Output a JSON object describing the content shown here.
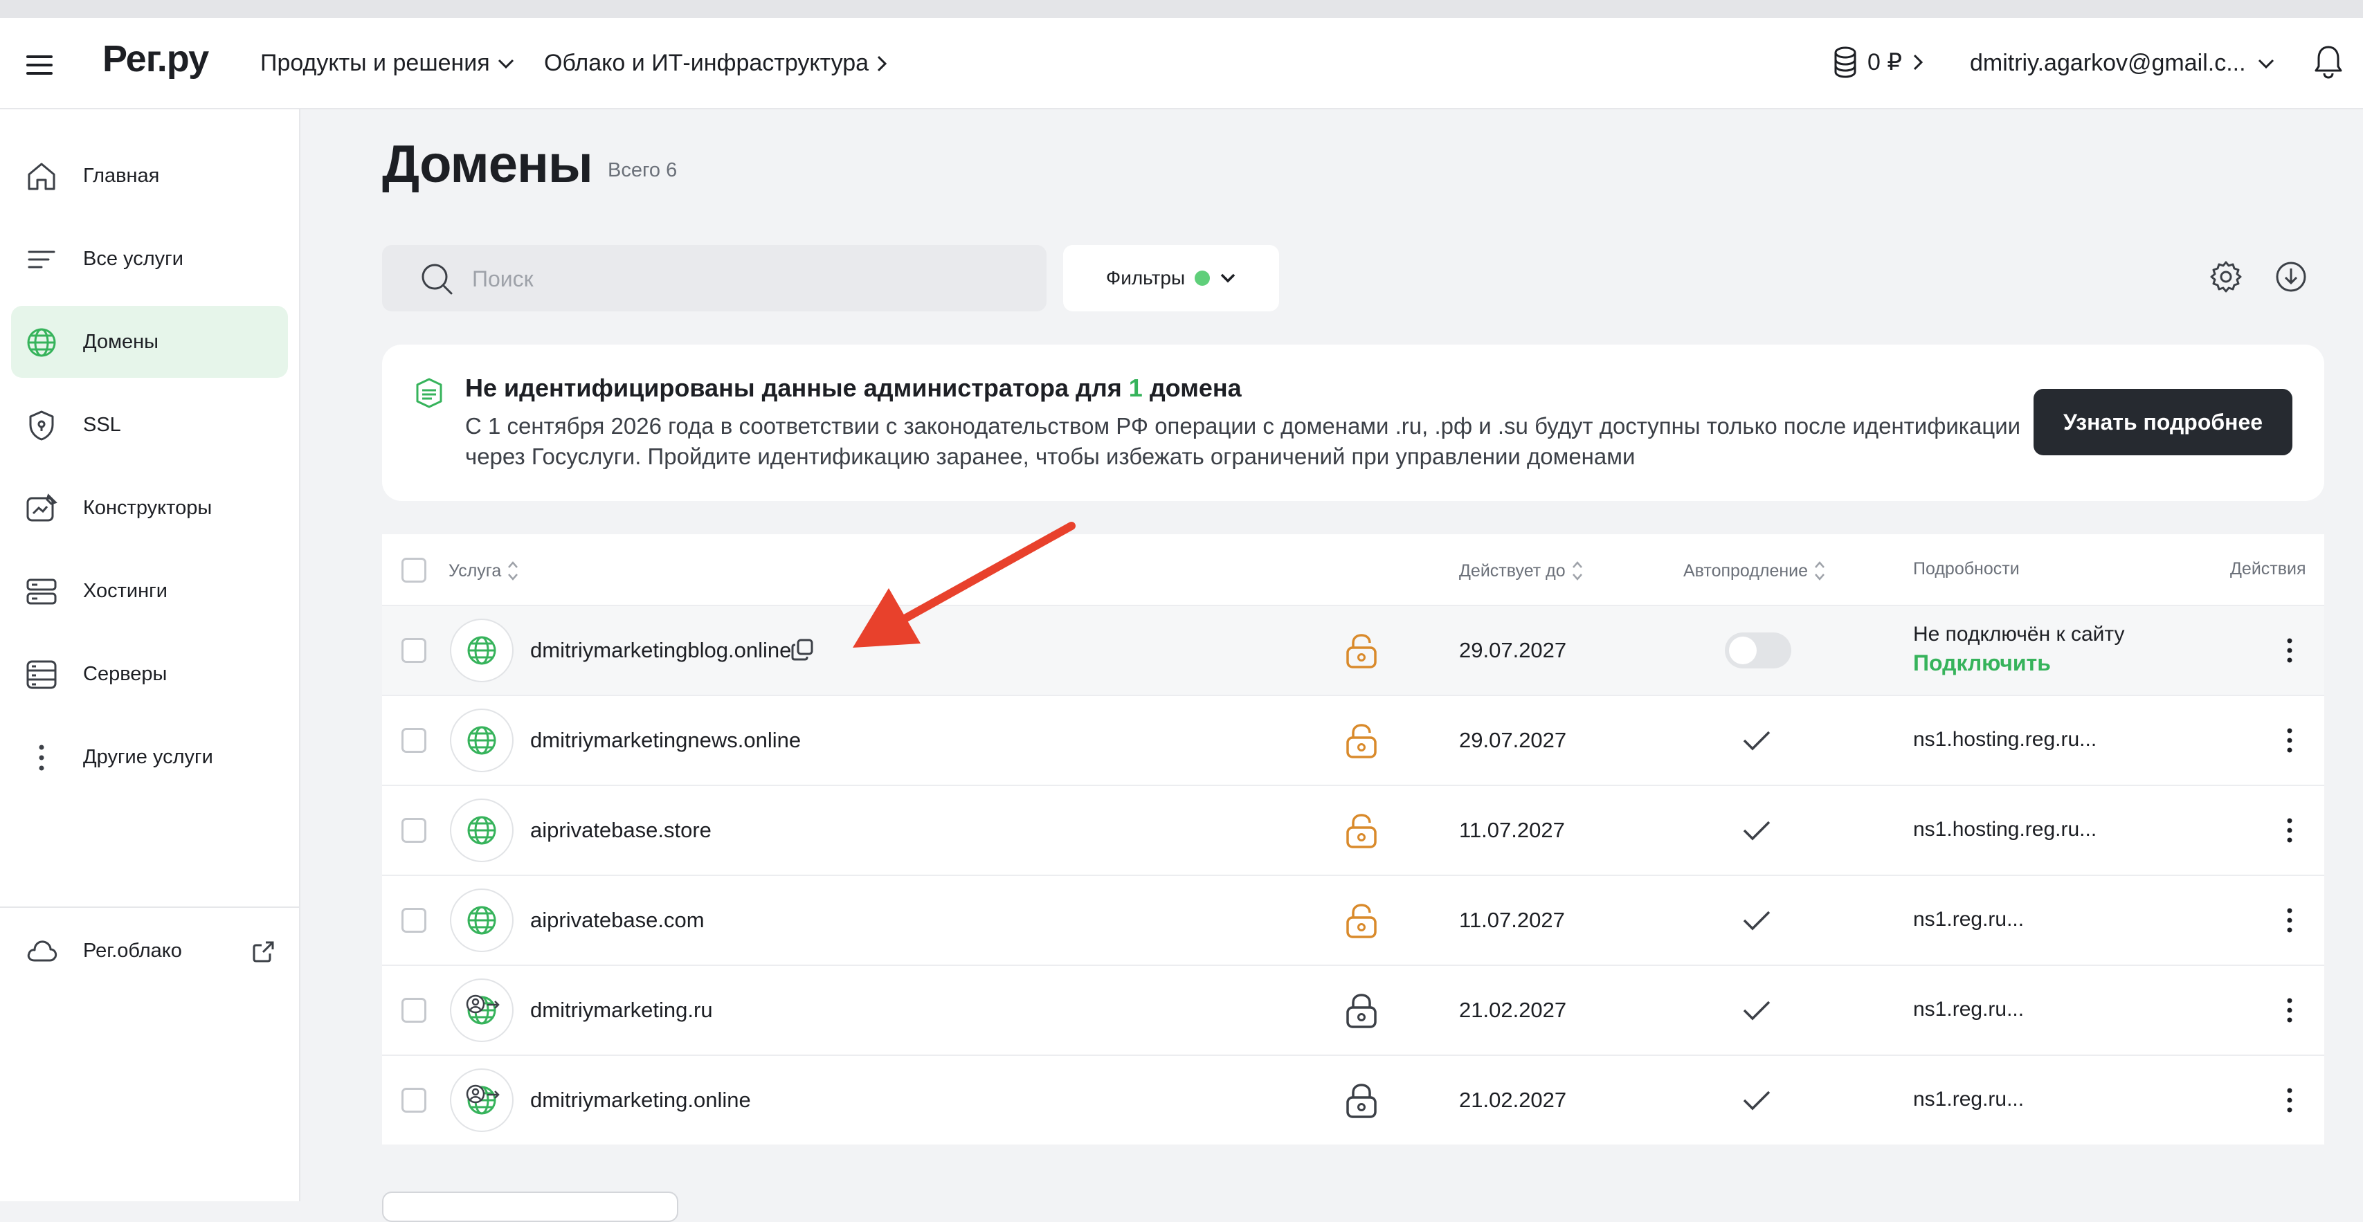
{
  "header": {
    "logo": "Рег.ру",
    "nav": [
      {
        "label": "Продукты и решения"
      },
      {
        "label": "Облако и ИТ-инфраструктура"
      }
    ],
    "balance": "0 ₽",
    "account_email": "dmitriy.agarkov@gmail.c..."
  },
  "sidebar": {
    "items": [
      {
        "label": "Главная",
        "icon": "home-icon"
      },
      {
        "label": "Все услуги",
        "icon": "list-icon"
      },
      {
        "label": "Домены",
        "icon": "globe-icon",
        "active": true
      },
      {
        "label": "SSL",
        "icon": "shield-icon"
      },
      {
        "label": "Конструкторы",
        "icon": "constructor-icon"
      },
      {
        "label": "Хостинги",
        "icon": "hosting-icon"
      },
      {
        "label": "Серверы",
        "icon": "server-icon"
      },
      {
        "label": "Другие услуги",
        "icon": "more-vertical-icon"
      }
    ],
    "cloud": {
      "label": "Рег.облако",
      "icon": "cloud-icon"
    }
  },
  "page": {
    "title": "Домены",
    "count": "Всего 6"
  },
  "search": {
    "placeholder": "Поиск",
    "value": ""
  },
  "filters": {
    "label": "Фильтры",
    "indicator_color": "#5fcf7a"
  },
  "banner": {
    "title_before": "Не идентифицированы данные администратора для",
    "title_number": "1",
    "title_after": "домена",
    "text": "С 1 сентября 2026 года в соответствии с законодательством РФ операции с доменами .ru, .рф и .su будут доступны только после идентификации через Госуслуги. Пройдите идентификацию заранее, чтобы избежать ограничений при управлении доменами",
    "button": "Узнать подробнее"
  },
  "table": {
    "columns": {
      "service": "Услуга",
      "valid_until": "Действует до",
      "autorenew": "Автопродление",
      "details": "Подробности",
      "actions": "Действия"
    },
    "rows": [
      {
        "domain": "dmitriymarketingblog.online",
        "lock_color": "orange",
        "date": "29.07.2027",
        "autorenew": false,
        "details": "Не подключён к сайту",
        "action_link": "Подключить",
        "user_badge": false
      },
      {
        "domain": "dmitriymarketingnews.online",
        "lock_color": "orange",
        "date": "29.07.2027",
        "autorenew": true,
        "details": "ns1.hosting.reg.ru...",
        "user_badge": false
      },
      {
        "domain": "aiprivatebase.store",
        "lock_color": "orange",
        "date": "11.07.2027",
        "autorenew": true,
        "details": "ns1.hosting.reg.ru...",
        "user_badge": false
      },
      {
        "domain": "aiprivatebase.com",
        "lock_color": "orange",
        "date": "11.07.2027",
        "autorenew": true,
        "details": "ns1.reg.ru...",
        "user_badge": false
      },
      {
        "domain": "dmitriymarketing.ru",
        "lock_color": "gray",
        "date": "21.02.2027",
        "autorenew": true,
        "details": "ns1.reg.ru...",
        "user_badge": true
      },
      {
        "domain": "dmitriymarketing.online",
        "lock_color": "gray",
        "date": "21.02.2027",
        "autorenew": true,
        "details": "ns1.reg.ru...",
        "user_badge": true
      }
    ]
  },
  "colors": {
    "accent_green": "#36b35b",
    "lock_orange": "#d98a2b",
    "annotation_arrow": "#e8412c"
  }
}
